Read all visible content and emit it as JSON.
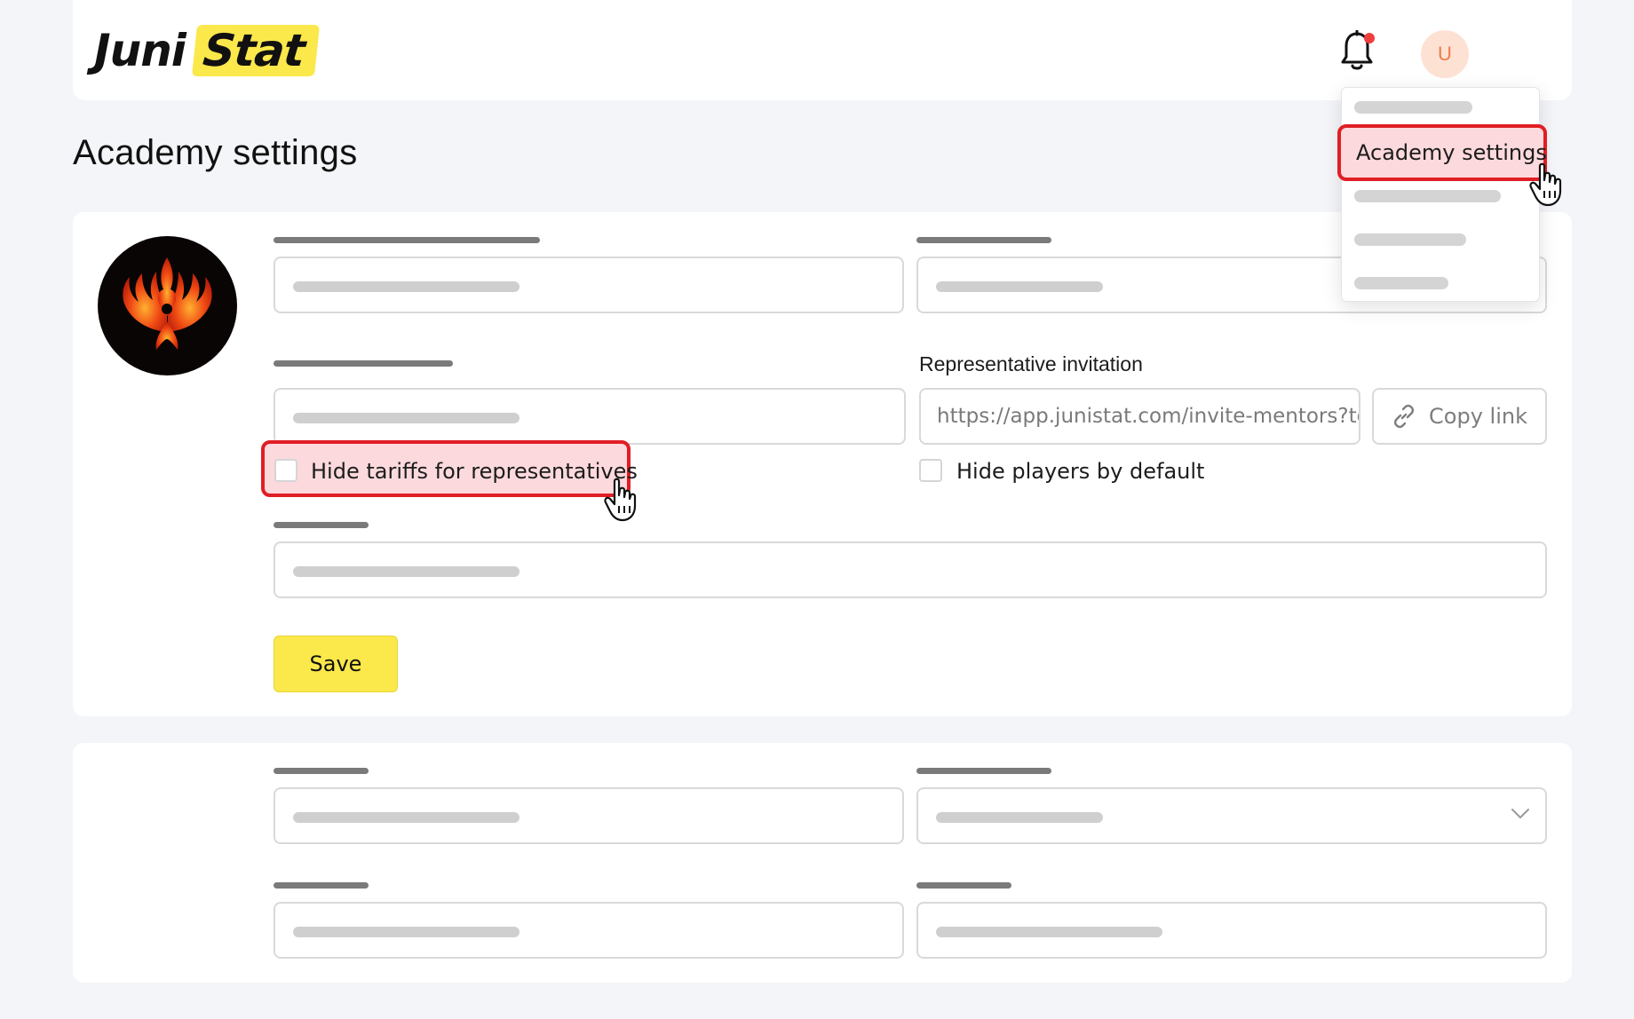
{
  "header": {
    "logo_part1": "Juni",
    "logo_part2": "Stat",
    "notification_icon": "bell-icon",
    "user_initial": "U"
  },
  "page": {
    "title": "Academy settings"
  },
  "user_menu": {
    "active_item": "Academy settings"
  },
  "representative": {
    "label": "Representative invitation",
    "link_value": "https://app.junistat.com/invite-mentors?to",
    "copy_label": "Copy link",
    "copy_icon": "link-icon"
  },
  "checkboxes": {
    "hide_tariffs": "Hide tariffs for representatives",
    "hide_players": "Hide players by default"
  },
  "actions": {
    "save": "Save"
  },
  "colors": {
    "accent_yellow": "#fbe84b",
    "highlight_red": "#e01e25",
    "highlight_fill": "#fcd9dc",
    "avatar_bg": "#fde2d4",
    "avatar_text": "#f07a4a"
  }
}
